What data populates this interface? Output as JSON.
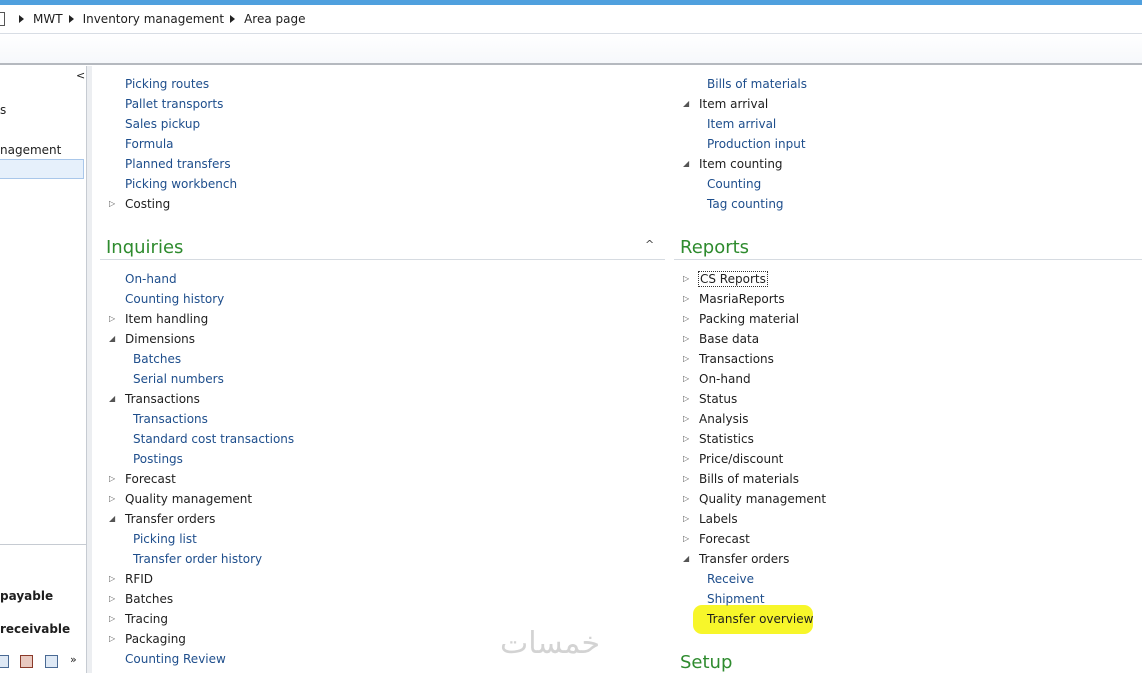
{
  "breadcrumb": [
    "MWT",
    "Inventory management",
    "Area page"
  ],
  "left_nav": {
    "fragments": [
      "s",
      "nagement"
    ],
    "modules": [
      "payable",
      "receivable"
    ],
    "more_glyph": "»"
  },
  "left_column": {
    "top_links": [
      "Picking routes",
      "Pallet transports",
      "Sales pickup",
      "Formula",
      "Planned transfers",
      "Picking workbench"
    ],
    "costing": "Costing",
    "inquiries": {
      "heading": "Inquiries",
      "collapse_glyph": "^",
      "items": [
        {
          "label": "On-hand",
          "type": "link"
        },
        {
          "label": "Counting history",
          "type": "link"
        },
        {
          "label": "Item handling",
          "type": "folder",
          "expanded": false
        },
        {
          "label": "Dimensions",
          "type": "folder",
          "expanded": true
        },
        {
          "label": "Batches",
          "type": "child"
        },
        {
          "label": "Serial numbers",
          "type": "child"
        },
        {
          "label": "Transactions",
          "type": "folder",
          "expanded": true
        },
        {
          "label": "Transactions",
          "type": "child"
        },
        {
          "label": "Standard cost transactions",
          "type": "child"
        },
        {
          "label": "Postings",
          "type": "child"
        },
        {
          "label": "Forecast",
          "type": "folder",
          "expanded": false
        },
        {
          "label": "Quality management",
          "type": "folder",
          "expanded": false
        },
        {
          "label": "Transfer orders",
          "type": "folder",
          "expanded": true
        },
        {
          "label": "Picking list",
          "type": "child"
        },
        {
          "label": "Transfer order history",
          "type": "child"
        },
        {
          "label": "RFID",
          "type": "folder",
          "expanded": false
        },
        {
          "label": "Batches",
          "type": "folder",
          "expanded": false
        },
        {
          "label": "Tracing",
          "type": "folder",
          "expanded": false
        },
        {
          "label": "Packaging",
          "type": "folder",
          "expanded": false
        },
        {
          "label": "Counting Review",
          "type": "link"
        }
      ]
    }
  },
  "right_column": {
    "top_items": [
      {
        "label": "Bills of materials",
        "type": "child"
      },
      {
        "label": "Item arrival",
        "type": "folder",
        "expanded": true
      },
      {
        "label": "Item arrival",
        "type": "child"
      },
      {
        "label": "Production input",
        "type": "child"
      },
      {
        "label": "Item counting",
        "type": "folder",
        "expanded": true
      },
      {
        "label": "Counting",
        "type": "child"
      },
      {
        "label": "Tag counting",
        "type": "child"
      }
    ],
    "reports": {
      "heading": "Reports",
      "items": [
        {
          "label": "CS Reports",
          "type": "folder",
          "expanded": false,
          "focused": true
        },
        {
          "label": "MasriaReports",
          "type": "folder",
          "expanded": false
        },
        {
          "label": "Packing material",
          "type": "folder",
          "expanded": false
        },
        {
          "label": "Base data",
          "type": "folder",
          "expanded": false
        },
        {
          "label": "Transactions",
          "type": "folder",
          "expanded": false
        },
        {
          "label": "On-hand",
          "type": "folder",
          "expanded": false
        },
        {
          "label": "Status",
          "type": "folder",
          "expanded": false
        },
        {
          "label": "Analysis",
          "type": "folder",
          "expanded": false
        },
        {
          "label": "Statistics",
          "type": "folder",
          "expanded": false
        },
        {
          "label": "Price/discount",
          "type": "folder",
          "expanded": false
        },
        {
          "label": "Bills of materials",
          "type": "folder",
          "expanded": false
        },
        {
          "label": "Quality management",
          "type": "folder",
          "expanded": false
        },
        {
          "label": "Labels",
          "type": "folder",
          "expanded": false
        },
        {
          "label": "Forecast",
          "type": "folder",
          "expanded": false
        },
        {
          "label": "Transfer orders",
          "type": "folder",
          "expanded": true
        },
        {
          "label": "Receive",
          "type": "child"
        },
        {
          "label": "Shipment",
          "type": "child"
        },
        {
          "label": "Transfer overview",
          "type": "child",
          "highlighted": true
        }
      ]
    },
    "setup_heading": "Setup"
  },
  "glyphs": {
    "collapsed": "▷",
    "expanded": "◢",
    "nav_collapse": "<"
  },
  "watermark": "خمسات",
  "colors": {
    "link": "#1e4e8c",
    "heading": "#2e8b2e",
    "highlight": "#f7f62a",
    "accent_bar": "#4fa0de"
  }
}
